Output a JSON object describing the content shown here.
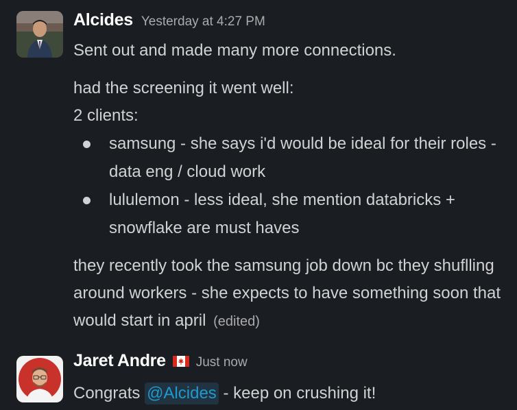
{
  "messages": [
    {
      "sender": "Alcides",
      "timestamp": "Yesterday at 4:27 PM",
      "line1": "Sent out and made many more connections.",
      "line2": "had the screening it went well:",
      "line3": "2 clients:",
      "bullets": [
        "samsung - she says i'd would be ideal for their roles - data eng / cloud work",
        "lululemon - less ideal, she mention databricks + snowflake are must haves"
      ],
      "line4": "they recently took the samsung job down bc they shuflling around workers - she expects to have something soon that would start in april",
      "edited": "(edited)"
    },
    {
      "sender": "Jaret Andre",
      "status_emoji": "canada-flag-icon",
      "timestamp": "Just now",
      "text_before": "Congrats ",
      "mention": "@Alcides",
      "text_after": " - keep on crushing it!"
    }
  ],
  "colors": {
    "background": "#1a1d21",
    "text": "#d1d2d3",
    "muted": "#ababad",
    "mention_text": "#1d9bd1",
    "mention_bg": "#213340"
  }
}
